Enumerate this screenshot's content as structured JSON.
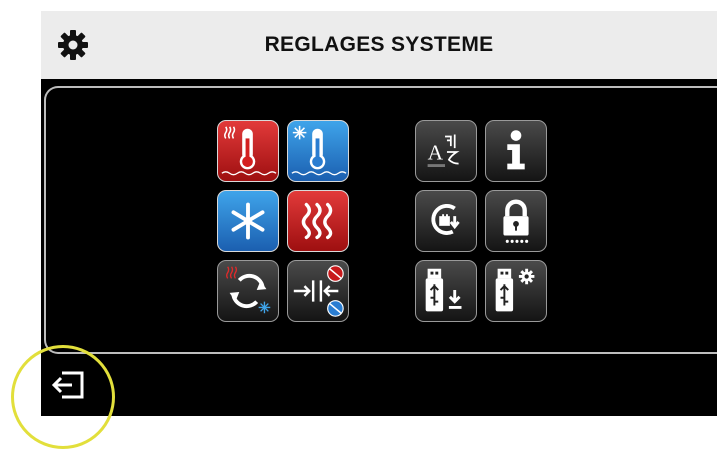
{
  "header": {
    "title": "REGLAGES SYSTEME",
    "icon": "gear-icon"
  },
  "left_group": [
    {
      "name": "heating-temperature-icon",
      "color": "#c8191b"
    },
    {
      "name": "cooling-temperature-icon",
      "color": "#2a7dd1"
    },
    {
      "name": "snowflake-icon",
      "color": "#2a7dd1"
    },
    {
      "name": "heat-waves-icon",
      "color": "#c8191b"
    },
    {
      "name": "heat-cool-changeover-icon",
      "color": "#333333"
    },
    {
      "name": "deadband-icon",
      "color": "#333333"
    }
  ],
  "right_group": [
    {
      "name": "language-icon"
    },
    {
      "name": "info-icon"
    },
    {
      "name": "restore-settings-icon"
    },
    {
      "name": "lock-icon"
    },
    {
      "name": "usb-download-icon"
    },
    {
      "name": "usb-settings-icon"
    }
  ],
  "footer": {
    "exit_icon": "exit-icon",
    "highlight_color": "#e2df3b"
  }
}
